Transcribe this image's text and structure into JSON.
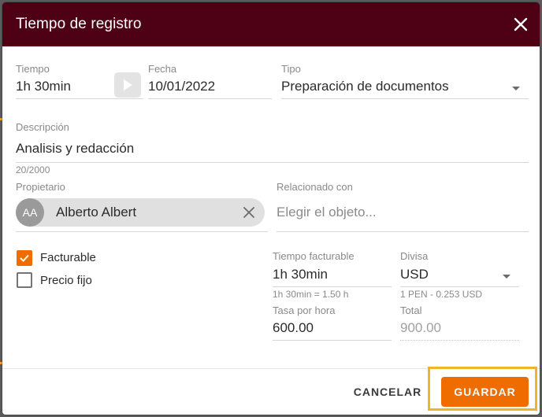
{
  "dialog": {
    "title": "Tiempo de registro"
  },
  "fields": {
    "tiempo": {
      "label": "Tiempo",
      "value": "1h 30min"
    },
    "fecha": {
      "label": "Fecha",
      "value": "10/01/2022"
    },
    "tipo": {
      "label": "Tipo",
      "value": "Preparación de documentos"
    },
    "descripcion": {
      "label": "Descripción",
      "value": "Analisis y redacción",
      "counter": "20/2000"
    },
    "propietario": {
      "label": "Propietario",
      "initials": "AA",
      "name": "Alberto Albert"
    },
    "relacionado": {
      "label": "Relacionado con",
      "placeholder": "Elegir el objeto..."
    }
  },
  "checkboxes": {
    "facturable": {
      "label": "Facturable",
      "checked": true
    },
    "precio_fijo": {
      "label": "Precio fijo",
      "checked": false
    }
  },
  "billing": {
    "tiempo_facturable": {
      "label": "Tiempo facturable",
      "value": "1h 30min",
      "hint": "1h 30min = 1.50 h"
    },
    "divisa": {
      "label": "Divisa",
      "value": "USD",
      "hint": "1 PEN - 0.253 USD"
    },
    "tasa": {
      "label": "Tasa por hora",
      "value": "600.00"
    },
    "total": {
      "label": "Total",
      "value": "900.00"
    }
  },
  "footer": {
    "cancel_label": "CANCELAR",
    "save_label": "GUARDAR"
  },
  "colors": {
    "header": "#4e0015",
    "accent": "#ef6c00",
    "highlight": "#f0b429"
  },
  "icons": [
    "close-icon",
    "play-icon",
    "chevron-down-icon",
    "remove-icon",
    "check-icon"
  ]
}
